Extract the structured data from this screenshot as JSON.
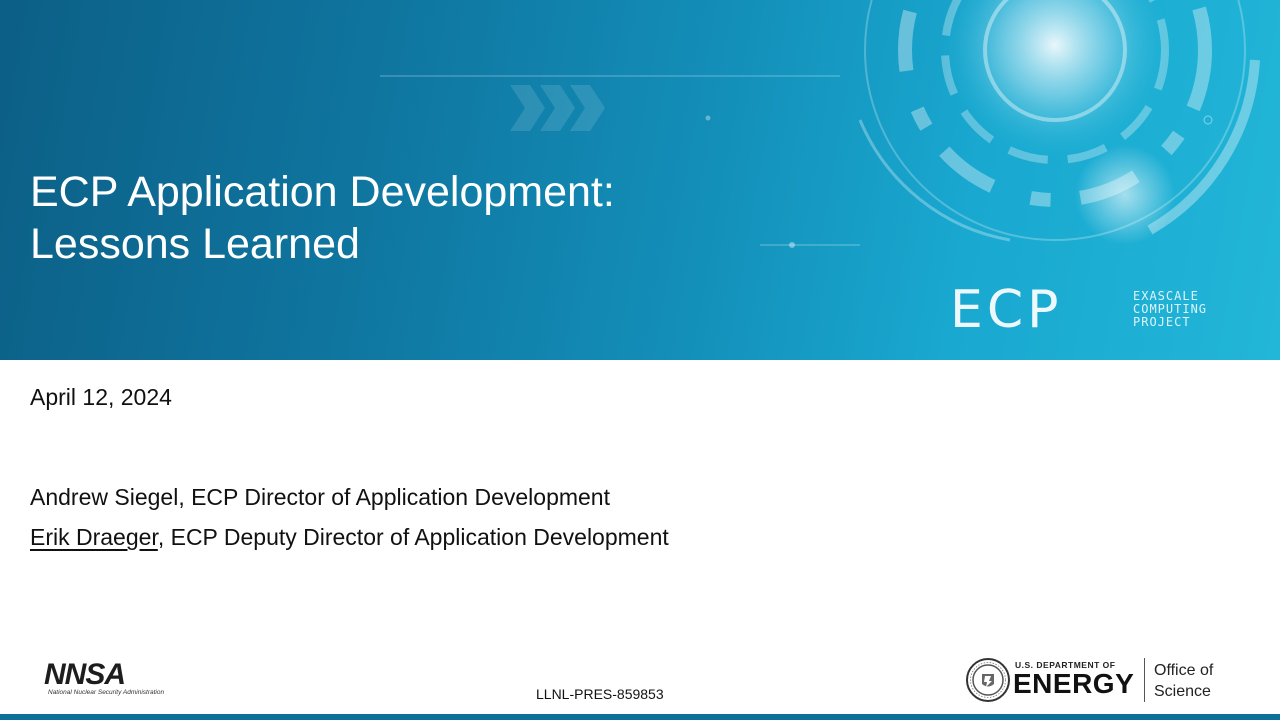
{
  "slide": {
    "title_line1": "ECP Application Development:",
    "title_line2": "Lessons Learned",
    "date": "April 12, 2024",
    "authors": [
      {
        "name": "Andrew Siegel",
        "role": ", ECP Director of Application Development"
      },
      {
        "name": "Erik Draeger",
        "role": ", ECP Deputy Director of Application Development"
      }
    ],
    "doc_id": "LLNL-PRES-859853"
  },
  "ecp_logo": {
    "letters": "ECP",
    "sub_line1": "EXASCALE",
    "sub_line2": "COMPUTING",
    "sub_line3": "PROJECT"
  },
  "nnsa_logo": {
    "letters": "NNSA",
    "subtitle": "National Nuclear Security Administration"
  },
  "doe_logo": {
    "department": "U.S. DEPARTMENT OF",
    "energy": "ENERGY",
    "office_line1": "Office of",
    "office_line2": "Science"
  },
  "colors": {
    "banner_dark": "#0c5f86",
    "banner_light": "#22b6d8",
    "text": "#111111"
  }
}
